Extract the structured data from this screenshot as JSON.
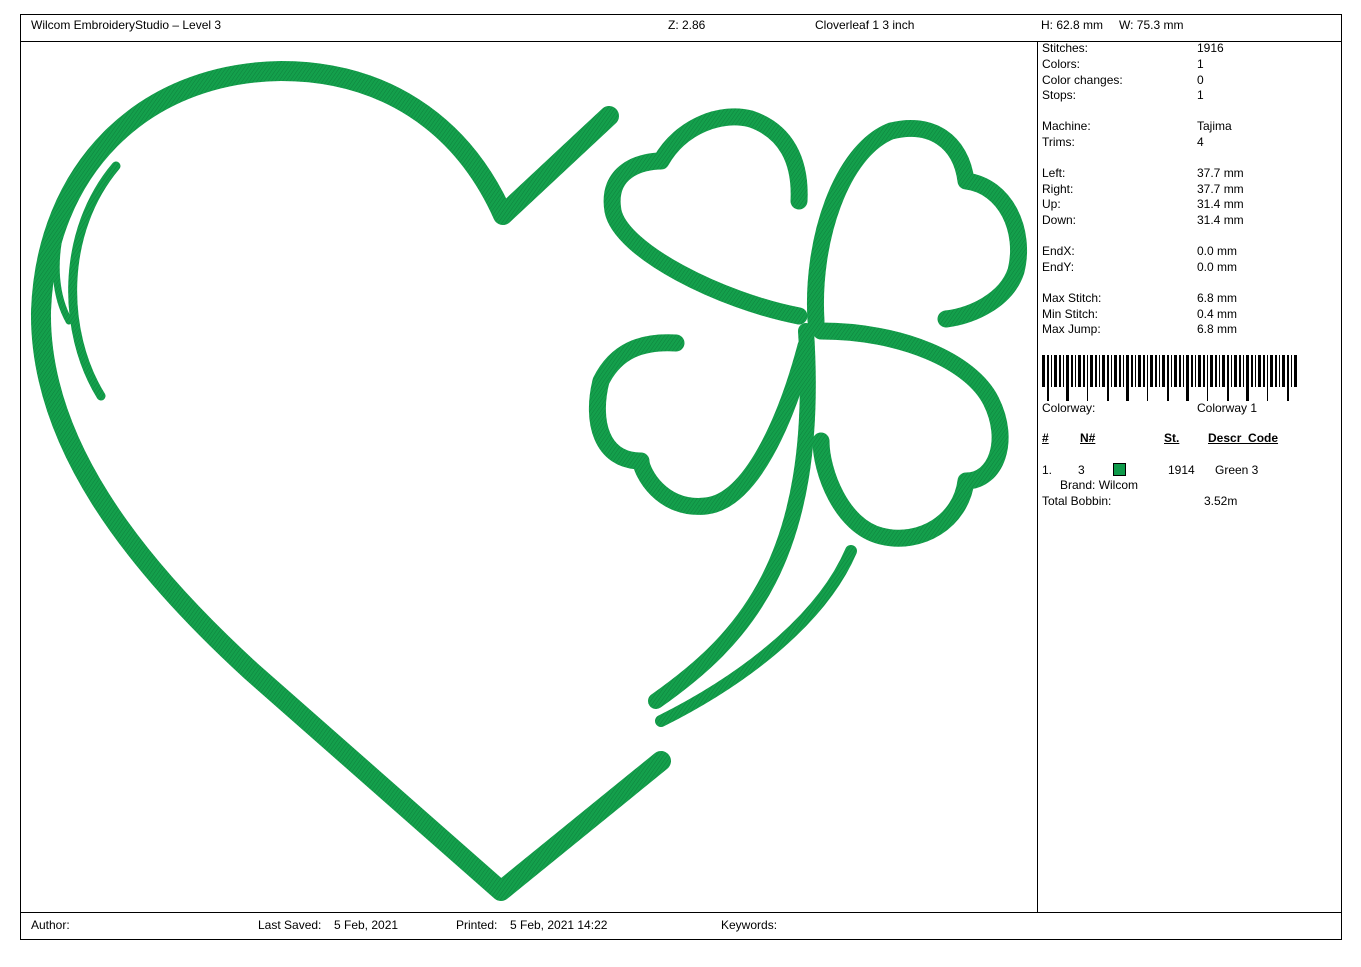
{
  "header": {
    "app_title": "Wilcom EmbroideryStudio – Level 3",
    "zoom": "Z: 2.86",
    "design_name": "Cloverleaf 1 3 inch",
    "height": "H: 62.8 mm",
    "width": "W: 75.3 mm"
  },
  "stats": [
    {
      "label": "Stitches:",
      "value": "1916"
    },
    {
      "label": "Colors:",
      "value": "1"
    },
    {
      "label": "Color changes:",
      "value": "0"
    },
    {
      "label": "Stops:",
      "value": "1"
    },
    {
      "label": "Machine:",
      "value": "Tajima"
    },
    {
      "label": "Trims:",
      "value": "4"
    },
    {
      "label": "Left:",
      "value": "37.7 mm"
    },
    {
      "label": "Right:",
      "value": "37.7 mm"
    },
    {
      "label": "Up:",
      "value": "31.4 mm"
    },
    {
      "label": "Down:",
      "value": "31.4 mm"
    },
    {
      "label": "EndX:",
      "value": "0.0 mm"
    },
    {
      "label": "EndY:",
      "value": "0.0 mm"
    },
    {
      "label": "Max Stitch:",
      "value": "6.8 mm"
    },
    {
      "label": "Min Stitch:",
      "value": "0.4 mm"
    },
    {
      "label": "Max Jump:",
      "value": "6.8 mm"
    }
  ],
  "colorway": {
    "label": "Colorway:",
    "value": "Colorway 1"
  },
  "table": {
    "headers": {
      "num": "#",
      "needle": "N#",
      "stitches": "St.",
      "descr": "Descr_Code"
    },
    "rows": [
      {
        "num": "1.",
        "needle": "3",
        "color": "#0e9a4a",
        "stitches": "1914",
        "descr": "Green 3",
        "brand": "Brand: Wilcom"
      }
    ]
  },
  "bobbin": {
    "label": "Total Bobbin:",
    "value": "3.52m"
  },
  "footer": {
    "author": "Author:",
    "last_saved_label": "Last Saved:",
    "last_saved": "5 Feb, 2021",
    "printed_label": "Printed:",
    "printed": "5 Feb, 2021 14:22",
    "keywords": "Keywords:"
  },
  "colors": {
    "thread": "#14a04c",
    "thread_dark": "#0b7a38",
    "border": "#000000"
  }
}
